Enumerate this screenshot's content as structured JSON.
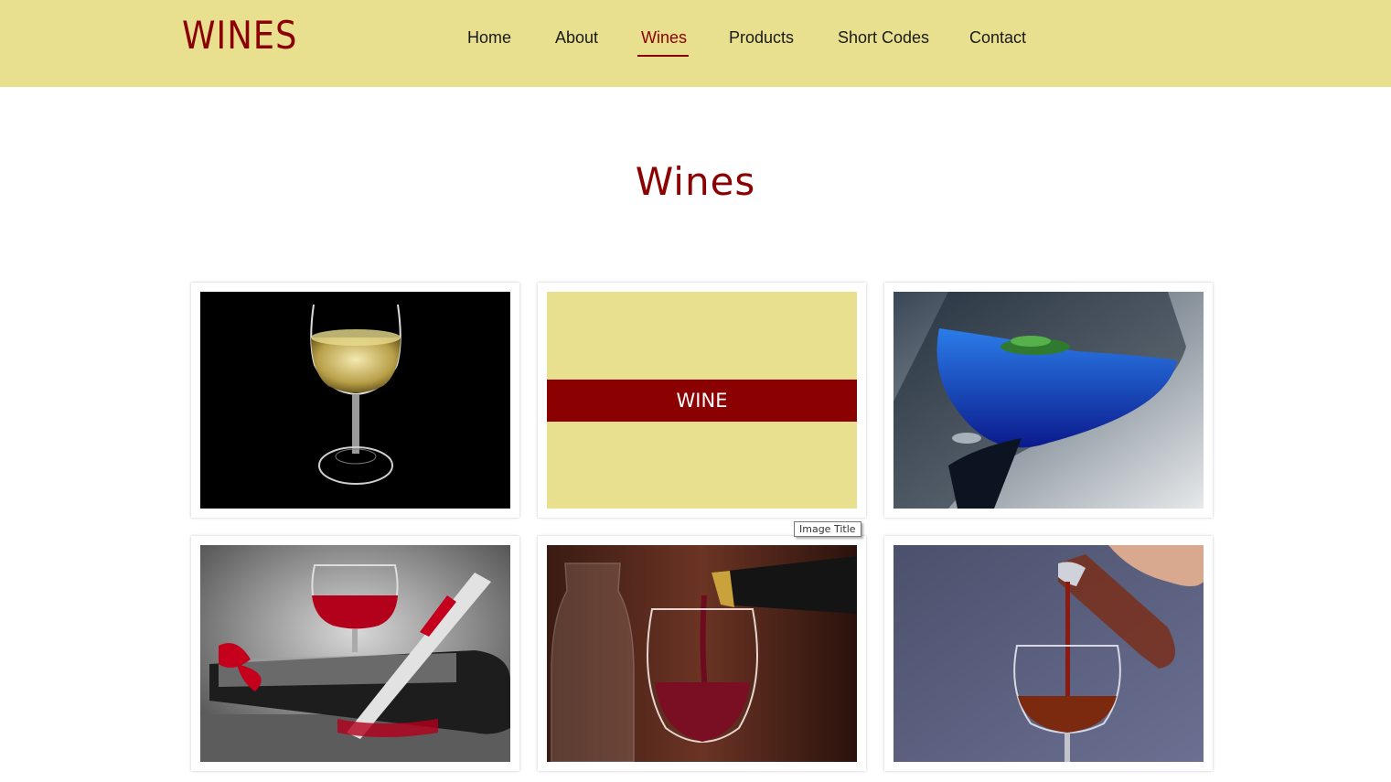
{
  "header": {
    "logo": "WINES",
    "nav": [
      {
        "label": "Home"
      },
      {
        "label": "About"
      },
      {
        "label": "Wines",
        "active": true
      },
      {
        "label": "Products"
      },
      {
        "label": "Short Codes"
      },
      {
        "label": "Contact"
      }
    ]
  },
  "main": {
    "title": "Wines",
    "gallery": {
      "hover_caption": "WINE",
      "tooltip": "Image Title"
    }
  },
  "colors": {
    "header_bg": "#e8e08e",
    "accent": "#8b0000",
    "page_bg": "#ffffff"
  }
}
